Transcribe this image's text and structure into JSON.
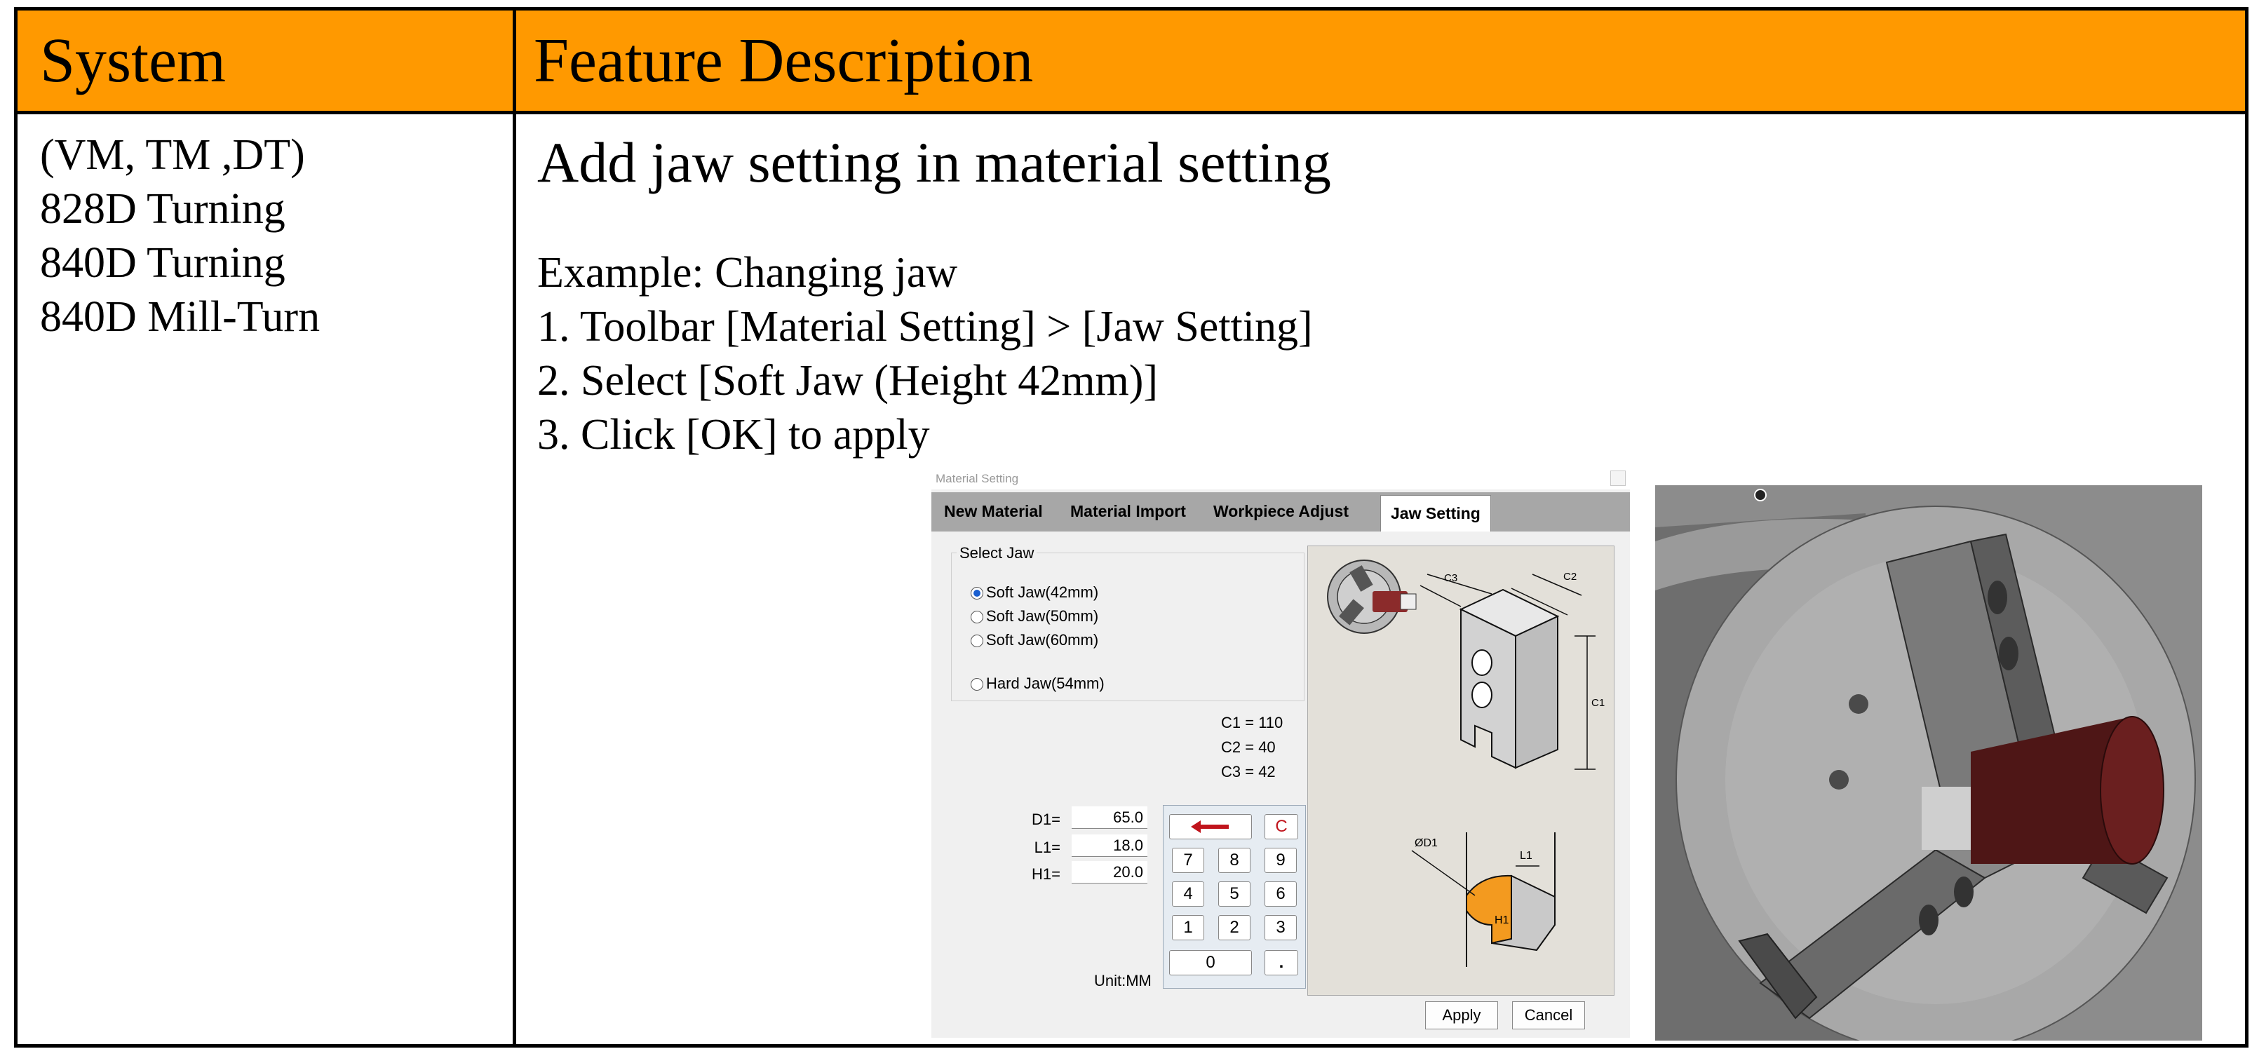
{
  "table": {
    "header_system": "System",
    "header_feature": "Feature Description",
    "systems": [
      "(VM, TM ,DT)",
      "828D Turning",
      "840D Turning",
      "840D Mill-Turn"
    ],
    "feature_title": "Add jaw setting in material setting",
    "example_label": "Example: Changing jaw",
    "steps": [
      "1. Toolbar [Material Setting] > [Jaw Setting]",
      "2. Select [Soft Jaw (Height 42mm)]",
      "3. Click [OK] to apply"
    ]
  },
  "dialog": {
    "title": "Material Setting",
    "tabs": [
      "New Material",
      "Material Import",
      "Workpiece Adjust",
      "Jaw Setting"
    ],
    "active_tab": "Jaw Setting",
    "select_jaw_title": "Select Jaw",
    "jaw_options": [
      "Soft Jaw(42mm)",
      "Soft Jaw(50mm)",
      "Soft Jaw(60mm)",
      "Hard Jaw(54mm)"
    ],
    "selected_jaw": "Soft Jaw(42mm)",
    "c_values": [
      "C1 = 110",
      "C2 = 40",
      "C3 = 42"
    ],
    "fields": [
      {
        "label": "D1=",
        "value": "65.0"
      },
      {
        "label": "L1=",
        "value": "18.0"
      },
      {
        "label": "H1=",
        "value": "20.0"
      }
    ],
    "keypad": {
      "clear": "C",
      "digits": [
        "7",
        "8",
        "9",
        "4",
        "5",
        "6",
        "1",
        "2",
        "3"
      ],
      "zero": "0",
      "dot": ".",
      "backspace_icon": "arrow-left-icon"
    },
    "unit": "Unit:MM",
    "diagram_labels": {
      "c1": "C1",
      "c2": "C2",
      "c3": "C3",
      "d1": "ØD1",
      "l1": "L1",
      "h1": "H1"
    },
    "apply_label": "Apply",
    "cancel_label": "Cancel"
  },
  "colors": {
    "header_bg": "#ff9900",
    "tab_bar_bg": "#a7a7a7",
    "diagram_bg": "#e3e0d9",
    "jaw_orange": "#f39a1f",
    "backspace_red": "#c0141c",
    "stock_red": "#5a1818"
  }
}
